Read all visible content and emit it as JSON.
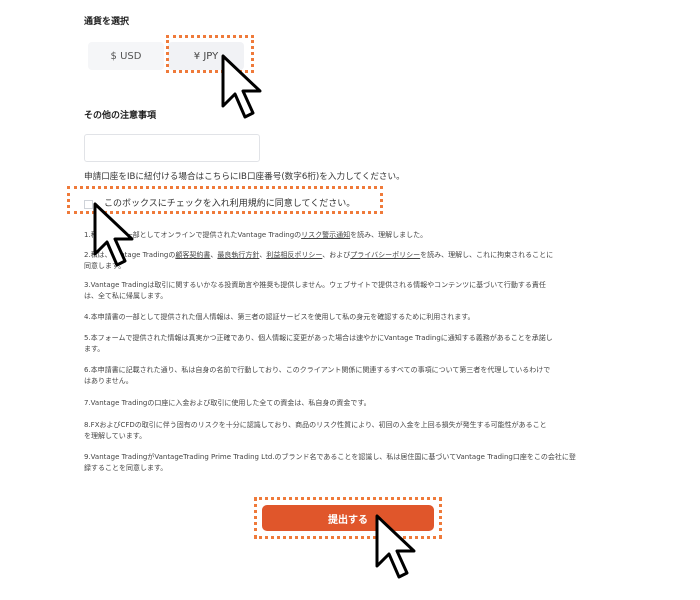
{
  "currency": {
    "title": "通貨を選択",
    "options": [
      "$ USD",
      "¥ JPY"
    ],
    "selected": "¥ JPY"
  },
  "notes": {
    "title": "その他の注意事項",
    "input_value": "",
    "ib_instruction": "申請口座をIBに紐付ける場合はこちらにIB口座番号(数字6桁)を入力してください。",
    "checkbox_label": "このボックスにチェックを入れ利用規約に同意してください。"
  },
  "clauses": [
    {
      "lines": [
        [
          "1.私",
          "申請書の一部としてオンラインで提供されたVantage Tradingの",
          "リスク警示通知",
          "を読み、理解しました。"
        ]
      ]
    },
    {
      "lines": [
        [
          "2.私は、",
          "Vantage Tradingの",
          "顧客契約書",
          "、",
          "最良執行方針",
          "、",
          "利益相反ポリシー",
          "、および",
          "プライバシーポリシー",
          "を読み、理解し、これに拘束されることに"
        ],
        [
          "同意します。"
        ]
      ]
    },
    {
      "lines": [
        [
          "3.Vantage Tradingは取引に関するいかなる投資助言や推奨も提供しません。ウェブサイトで提供される情報やコンテンツに基づいて行動する責任"
        ],
        [
          "は、全て私に帰属します。"
        ]
      ]
    },
    {
      "lines": [
        [
          "4.本申請書の一部として提供された個人情報は、第三者の認証サービスを使用して私の身元を確認するために利用されます。"
        ]
      ]
    },
    {
      "lines": [
        [
          "5.本フォームで提供された情報は真実かつ正確であり、個人情報に変更があった場合は速やかにVantage Tradingに通知する義務があることを承諾し"
        ],
        [
          "ます。"
        ]
      ]
    },
    {
      "lines": [
        [
          "6.本申請書に記載された通り、私は自身の名前で行動しており、このクライアント関係に関連するすべての事項について第三者を代理しているわけで"
        ],
        [
          "はありません。"
        ]
      ]
    },
    {
      "lines": [
        [
          "7.Vantage Tradingの口座に入金および取引に使用した全ての資金は、私自身の資金です。"
        ]
      ]
    },
    {
      "lines": [
        [
          "8.FXおよびCFDの取引に伴う固有のリスクを十分に認識しており、商品のリスク性質により、初回の入金を上回る損失が発生する可能性があること"
        ],
        [
          "を理解しています。"
        ]
      ]
    },
    {
      "lines": [
        [
          "9.Vantage TradingがVantageTrading Prime Trading Ltd.のブランド名であることを認識し、私は居住国に基づいてVantage Trading口座をこの会社に登"
        ],
        [
          "録することを同意します。"
        ]
      ]
    }
  ],
  "submit_label": "提出する"
}
